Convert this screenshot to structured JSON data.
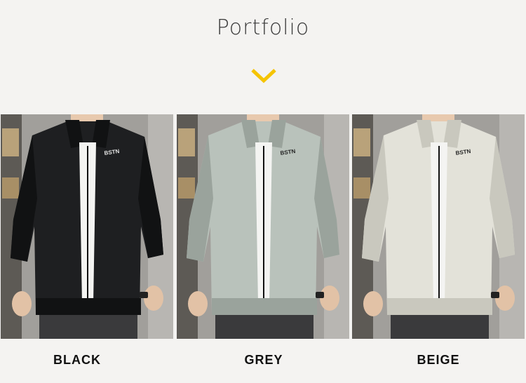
{
  "header": {
    "title": "Portfolio",
    "chevron_icon": "chevron-down-icon",
    "accent_color": "#f5c400"
  },
  "products": [
    {
      "label": "BLACK",
      "jacket_color": "#1e1f21",
      "jacket_shade": "#111213",
      "chest_print": "BSTN"
    },
    {
      "label": "GREY",
      "jacket_color": "#b9c2bb",
      "jacket_shade": "#9aa39c",
      "chest_print": "BSTN"
    },
    {
      "label": "BEIGE",
      "jacket_color": "#e3e2d9",
      "jacket_shade": "#c9c8be",
      "chest_print": "BSTN"
    }
  ]
}
